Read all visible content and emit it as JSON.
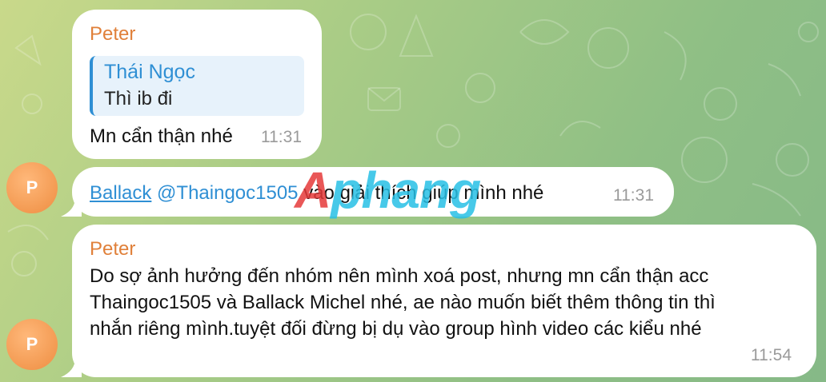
{
  "messages": [
    {
      "sender": "Peter",
      "reply_to": {
        "name": "Thái Ngọc",
        "text": "Thì ib đi"
      },
      "text": "Mn cẩn thận nhé",
      "time": "11:31"
    },
    {
      "avatar_letter": "P",
      "link": "Ballack",
      "mention": "@Thaingoc1505",
      "text": " vào giải thích giúp mình nhé",
      "time": "11:31"
    },
    {
      "avatar_letter": "P",
      "sender": "Peter",
      "lines": [
        "Do sợ ảnh hưởng đến nhóm nên mình xoá post, nhưng mn cẩn thận acc",
        "Thaingoc1505 và Ballack Michel nhé, ae nào muốn biết thêm thông tin thì",
        "nhắn riêng mình.tuyệt đối đừng bị dụ vào group hình video các kiểu nhé"
      ],
      "time": "11:54"
    }
  ],
  "watermark": {
    "part1": "Aphang",
    "color1": "#e63a3a",
    "color2": "#27c0e6"
  },
  "colors": {
    "sender": "#e0803a",
    "link": "#2f8fd4",
    "avatar": "#f39a52"
  }
}
